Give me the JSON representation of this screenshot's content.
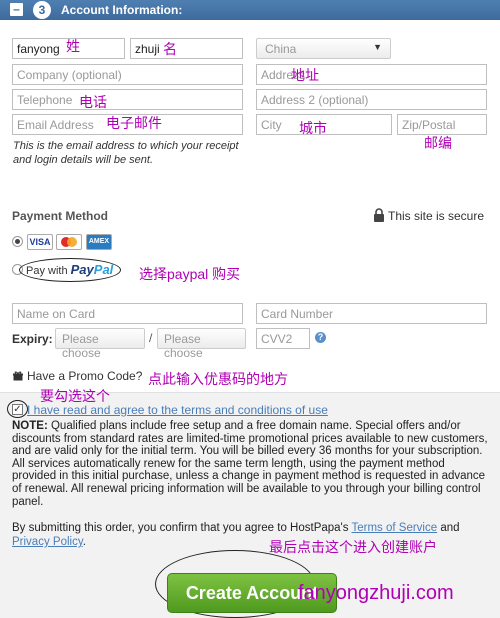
{
  "header": {
    "minus": "–",
    "step": "3",
    "title": "Account Information:"
  },
  "form": {
    "first_name": "fanyong",
    "last_name": "zhuji",
    "country": "China",
    "company_placeholder": "Company (optional)",
    "address_placeholder": "Address",
    "telephone_placeholder": "Telephone",
    "address2_placeholder": "Address 2 (optional)",
    "email_placeholder": "Email Address",
    "city_placeholder": "City",
    "zip_placeholder": "Zip/Postal",
    "email_note_line1": "This is the email address to which your receipt",
    "email_note_line2": "and login details will be sent."
  },
  "annotations": {
    "surname": "姓",
    "given_name": "名",
    "address": "地址",
    "telephone": "电话",
    "email": "电子邮件",
    "city": "城市",
    "zip": "邮编",
    "choose_paypal": "选择paypal 购买",
    "promo_hint": "点此输入优惠码的地方",
    "must_check": "要勾选这个",
    "final_click": "最后点击这个进入创建账户"
  },
  "payment": {
    "title": "Payment Method",
    "secure_text": "This site is secure",
    "cards": [
      "VISA",
      "MC",
      "AMEX"
    ],
    "paypal_prefix": "Pay with",
    "paypal_brand_a": "Pay",
    "paypal_brand_b": "Pal",
    "name_on_card": "Name on Card",
    "card_number": "Card Number",
    "expiry_label": "Expiry:",
    "month_placeholder": "Please choose",
    "slash": "/",
    "year_placeholder": "Please choose",
    "cvv": "CVV2",
    "help": "?"
  },
  "promo": {
    "label": "Have a Promo Code?"
  },
  "terms": {
    "check_mark": "✓",
    "text": "I have read and agree to the terms and conditions of use"
  },
  "note": {
    "label": "NOTE:",
    "text": " Qualified plans include free setup and a free domain name. Special offers and/or discounts from standard rates are limited-time promotional prices available to new customers, and are valid only for the initial term. You will be billed every 36 months for your subscription. All services automatically renew for the same term length, using the payment method provided in this initial purchase, unless a change in payment method is requested in advance of renewal. All renewal pricing information will be available to you through your billing control panel."
  },
  "submit": {
    "prefix": "By submitting this order, you confirm that you agree to HostPapa's ",
    "tos_link": "Terms of Service",
    "and": " and ",
    "privacy_link": "Privacy Policy",
    "suffix": ".",
    "button": "Create Account"
  },
  "watermark": "fanyongzhuji.com"
}
